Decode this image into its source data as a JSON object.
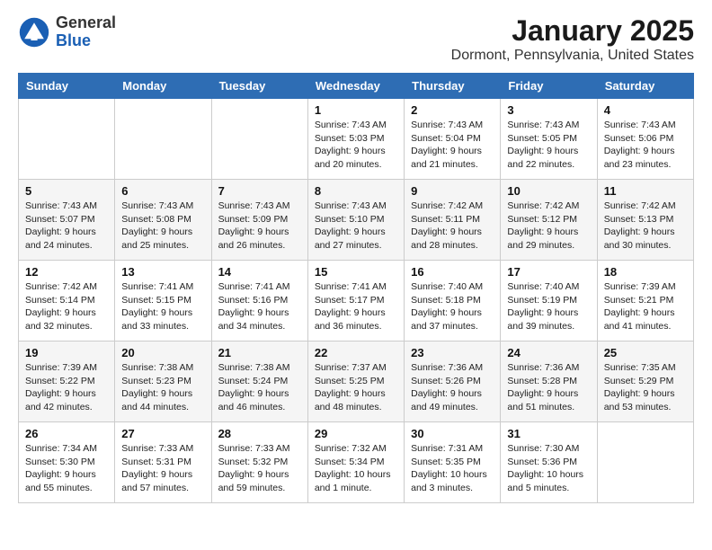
{
  "header": {
    "logo_general": "General",
    "logo_blue": "Blue",
    "month_title": "January 2025",
    "location": "Dormont, Pennsylvania, United States"
  },
  "weekdays": [
    "Sunday",
    "Monday",
    "Tuesday",
    "Wednesday",
    "Thursday",
    "Friday",
    "Saturday"
  ],
  "weeks": [
    [
      {
        "day": "",
        "info": ""
      },
      {
        "day": "",
        "info": ""
      },
      {
        "day": "",
        "info": ""
      },
      {
        "day": "1",
        "info": "Sunrise: 7:43 AM\nSunset: 5:03 PM\nDaylight: 9 hours\nand 20 minutes."
      },
      {
        "day": "2",
        "info": "Sunrise: 7:43 AM\nSunset: 5:04 PM\nDaylight: 9 hours\nand 21 minutes."
      },
      {
        "day": "3",
        "info": "Sunrise: 7:43 AM\nSunset: 5:05 PM\nDaylight: 9 hours\nand 22 minutes."
      },
      {
        "day": "4",
        "info": "Sunrise: 7:43 AM\nSunset: 5:06 PM\nDaylight: 9 hours\nand 23 minutes."
      }
    ],
    [
      {
        "day": "5",
        "info": "Sunrise: 7:43 AM\nSunset: 5:07 PM\nDaylight: 9 hours\nand 24 minutes."
      },
      {
        "day": "6",
        "info": "Sunrise: 7:43 AM\nSunset: 5:08 PM\nDaylight: 9 hours\nand 25 minutes."
      },
      {
        "day": "7",
        "info": "Sunrise: 7:43 AM\nSunset: 5:09 PM\nDaylight: 9 hours\nand 26 minutes."
      },
      {
        "day": "8",
        "info": "Sunrise: 7:43 AM\nSunset: 5:10 PM\nDaylight: 9 hours\nand 27 minutes."
      },
      {
        "day": "9",
        "info": "Sunrise: 7:42 AM\nSunset: 5:11 PM\nDaylight: 9 hours\nand 28 minutes."
      },
      {
        "day": "10",
        "info": "Sunrise: 7:42 AM\nSunset: 5:12 PM\nDaylight: 9 hours\nand 29 minutes."
      },
      {
        "day": "11",
        "info": "Sunrise: 7:42 AM\nSunset: 5:13 PM\nDaylight: 9 hours\nand 30 minutes."
      }
    ],
    [
      {
        "day": "12",
        "info": "Sunrise: 7:42 AM\nSunset: 5:14 PM\nDaylight: 9 hours\nand 32 minutes."
      },
      {
        "day": "13",
        "info": "Sunrise: 7:41 AM\nSunset: 5:15 PM\nDaylight: 9 hours\nand 33 minutes."
      },
      {
        "day": "14",
        "info": "Sunrise: 7:41 AM\nSunset: 5:16 PM\nDaylight: 9 hours\nand 34 minutes."
      },
      {
        "day": "15",
        "info": "Sunrise: 7:41 AM\nSunset: 5:17 PM\nDaylight: 9 hours\nand 36 minutes."
      },
      {
        "day": "16",
        "info": "Sunrise: 7:40 AM\nSunset: 5:18 PM\nDaylight: 9 hours\nand 37 minutes."
      },
      {
        "day": "17",
        "info": "Sunrise: 7:40 AM\nSunset: 5:19 PM\nDaylight: 9 hours\nand 39 minutes."
      },
      {
        "day": "18",
        "info": "Sunrise: 7:39 AM\nSunset: 5:21 PM\nDaylight: 9 hours\nand 41 minutes."
      }
    ],
    [
      {
        "day": "19",
        "info": "Sunrise: 7:39 AM\nSunset: 5:22 PM\nDaylight: 9 hours\nand 42 minutes."
      },
      {
        "day": "20",
        "info": "Sunrise: 7:38 AM\nSunset: 5:23 PM\nDaylight: 9 hours\nand 44 minutes."
      },
      {
        "day": "21",
        "info": "Sunrise: 7:38 AM\nSunset: 5:24 PM\nDaylight: 9 hours\nand 46 minutes."
      },
      {
        "day": "22",
        "info": "Sunrise: 7:37 AM\nSunset: 5:25 PM\nDaylight: 9 hours\nand 48 minutes."
      },
      {
        "day": "23",
        "info": "Sunrise: 7:36 AM\nSunset: 5:26 PM\nDaylight: 9 hours\nand 49 minutes."
      },
      {
        "day": "24",
        "info": "Sunrise: 7:36 AM\nSunset: 5:28 PM\nDaylight: 9 hours\nand 51 minutes."
      },
      {
        "day": "25",
        "info": "Sunrise: 7:35 AM\nSunset: 5:29 PM\nDaylight: 9 hours\nand 53 minutes."
      }
    ],
    [
      {
        "day": "26",
        "info": "Sunrise: 7:34 AM\nSunset: 5:30 PM\nDaylight: 9 hours\nand 55 minutes."
      },
      {
        "day": "27",
        "info": "Sunrise: 7:33 AM\nSunset: 5:31 PM\nDaylight: 9 hours\nand 57 minutes."
      },
      {
        "day": "28",
        "info": "Sunrise: 7:33 AM\nSunset: 5:32 PM\nDaylight: 9 hours\nand 59 minutes."
      },
      {
        "day": "29",
        "info": "Sunrise: 7:32 AM\nSunset: 5:34 PM\nDaylight: 10 hours\nand 1 minute."
      },
      {
        "day": "30",
        "info": "Sunrise: 7:31 AM\nSunset: 5:35 PM\nDaylight: 10 hours\nand 3 minutes."
      },
      {
        "day": "31",
        "info": "Sunrise: 7:30 AM\nSunset: 5:36 PM\nDaylight: 10 hours\nand 5 minutes."
      },
      {
        "day": "",
        "info": ""
      }
    ]
  ]
}
